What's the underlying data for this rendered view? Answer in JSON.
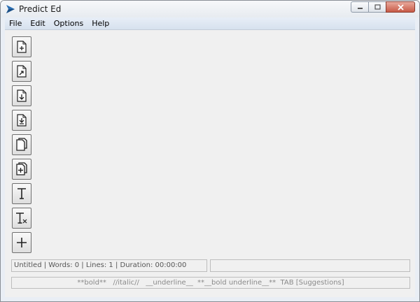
{
  "window": {
    "title": "Predict Ed"
  },
  "menu": [
    "File",
    "Edit",
    "Options",
    "Help"
  ],
  "toolbar": [
    {
      "name": "new-document-button",
      "icon": "file-new-icon"
    },
    {
      "name": "open-document-button",
      "icon": "file-open-icon"
    },
    {
      "name": "save-document-button",
      "icon": "file-save-icon"
    },
    {
      "name": "save-as-button",
      "icon": "file-save-as-icon"
    },
    {
      "name": "copy-button",
      "icon": "copy-icon"
    },
    {
      "name": "paste-add-button",
      "icon": "copy-add-icon"
    },
    {
      "name": "text-format-button",
      "icon": "text-icon"
    },
    {
      "name": "clear-format-button",
      "icon": "clear-text-icon"
    },
    {
      "name": "add-button",
      "icon": "plus-icon"
    }
  ],
  "status": {
    "info": "Untitled | Words: 0 | Lines: 1 | Duration: 00:00:00",
    "secondary": ""
  },
  "hint": "**bold**   //italic//   __underline__  **__bold underline__**  TAB [Suggestions]"
}
